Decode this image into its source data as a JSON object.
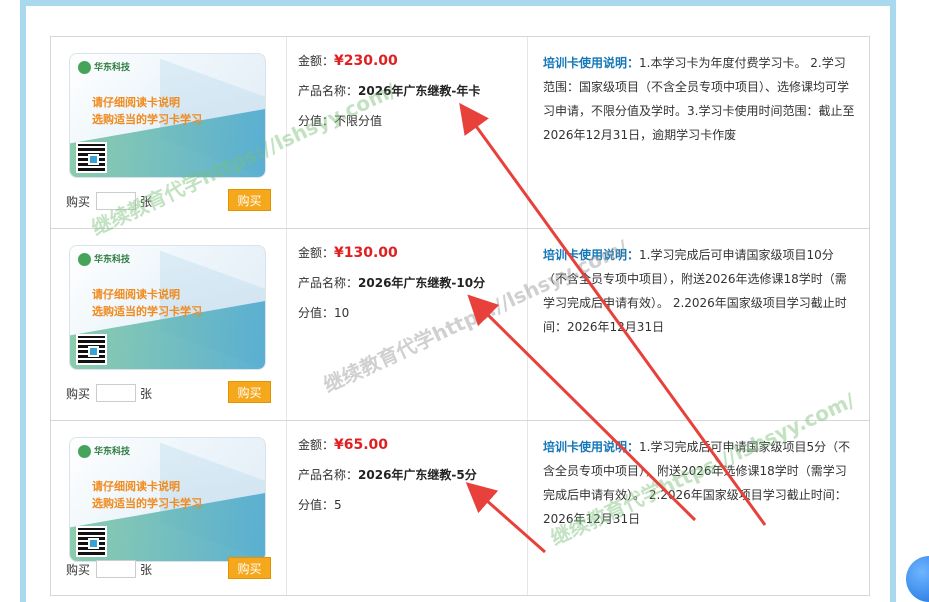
{
  "products": [
    {
      "card": {
        "brand": "华东科技",
        "line1": "请仔细阅读卡说明",
        "line2": "选购适当的学习卡学习"
      },
      "buy_label": "购买",
      "unit": "张",
      "buy_button": "购买",
      "amount_label": "金额：",
      "amount": "¥230.00",
      "name_label": "产品名称：",
      "name": "2026年广东继教-年卡",
      "score_label": "分值：",
      "score": "不限分值",
      "desc_head": "培训卡使用说明：",
      "desc": "1.本学习卡为年度付费学习卡。 2.学习范围：国家级项目（不含全员专项中项目）、选修课均可学习申请，不限分值及学时。3.学习卡使用时间范围：截止至2026年12月31日，逾期学习卡作废"
    },
    {
      "card": {
        "brand": "华东科技",
        "line1": "请仔细阅读卡说明",
        "line2": "选购适当的学习卡学习"
      },
      "buy_label": "购买",
      "unit": "张",
      "buy_button": "购买",
      "amount_label": "金额：",
      "amount": "¥130.00",
      "name_label": "产品名称：",
      "name": "2026年广东继教-10分",
      "score_label": "分值：",
      "score": "10",
      "desc_head": "培训卡使用说明：",
      "desc": "1.学习完成后可申请国家级项目10分（不含全员专项中项目），附送2026年选修课18学时（需学习完成后申请有效）。 2.2026年国家级项目学习截止时间：2026年12月31日"
    },
    {
      "card": {
        "brand": "华东科技",
        "line1": "请仔细阅读卡说明",
        "line2": "选购适当的学习卡学习"
      },
      "buy_label": "购买",
      "unit": "张",
      "buy_button": "购买",
      "amount_label": "金额：",
      "amount": "¥65.00",
      "name_label": "产品名称：",
      "name": "2026年广东继教-5分",
      "score_label": "分值：",
      "score": "5",
      "desc_head": "培训卡使用说明：",
      "desc": "1.学习完成后可申请国家级项目5分（不含全员专项中项目），附送2026年选修课18学时（需学习完成后申请有效）。 2.2026年国家级项目学习截止时间：2026年12月31日"
    }
  ],
  "watermark": "继续教育代学https://lshsyy.com/",
  "colors": {
    "price": "#e02020",
    "button": "#f5a81c",
    "desc_head": "#1678b8",
    "arrow": "#e8403a",
    "frame": "#a9d9ef"
  }
}
